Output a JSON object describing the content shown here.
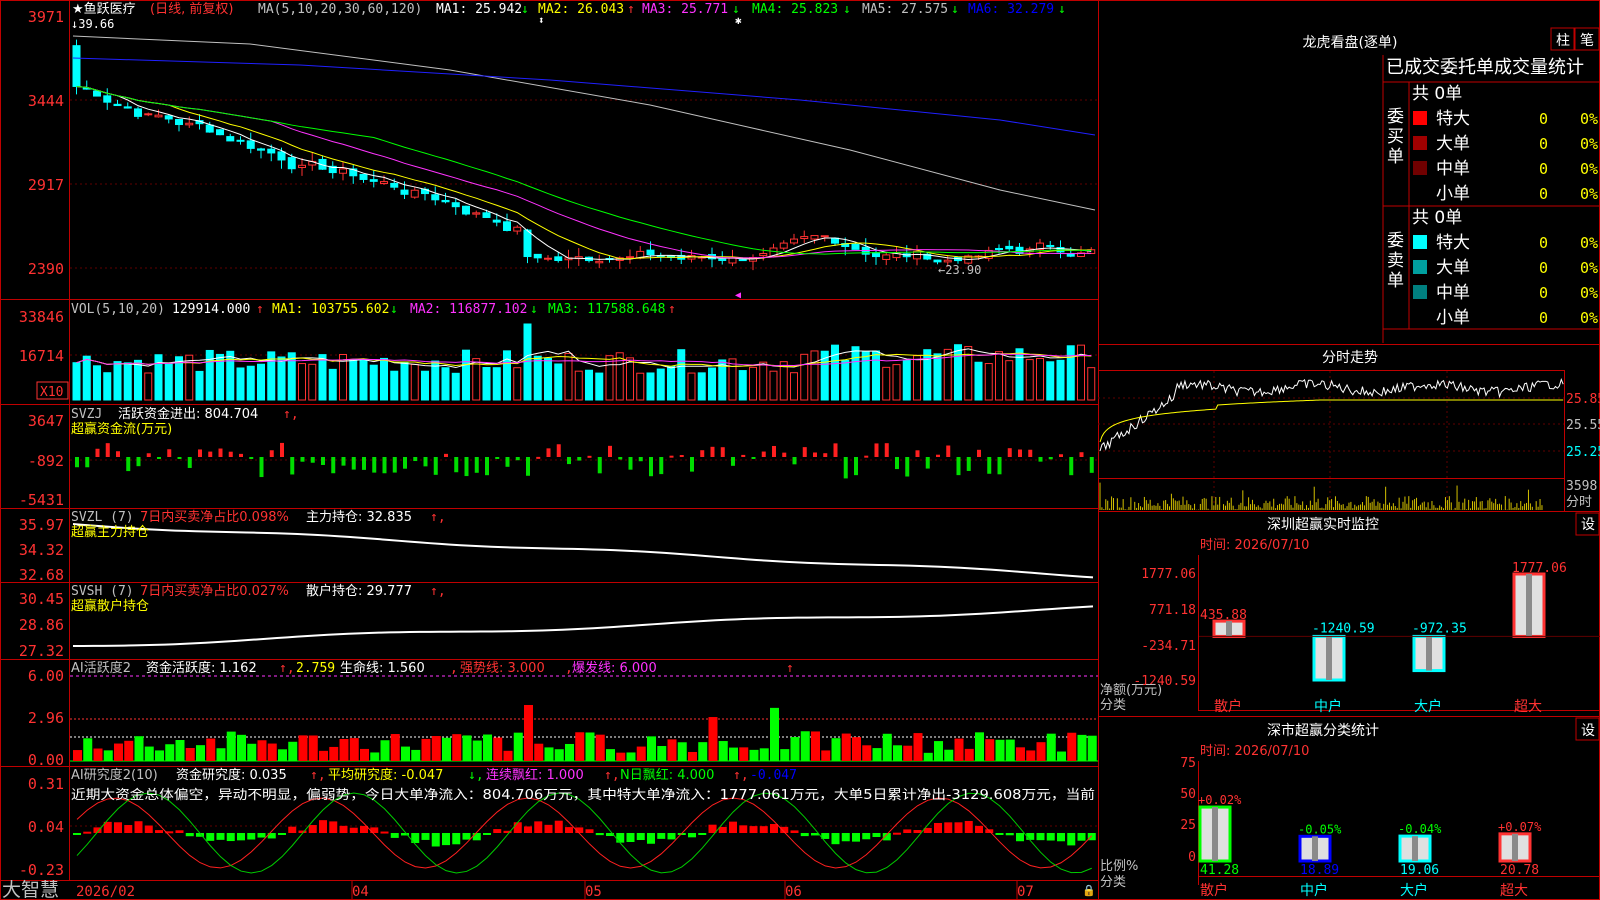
{
  "stock": {
    "name": "★鱼跃医疗",
    "period": "(日线, 前复权)",
    "ma_label": "MA(5,10,20,30,60,120)",
    "ma": [
      {
        "label": "MA1: 25.942",
        "arrow": "↓",
        "color": "#ffffff"
      },
      {
        "label": "MA2: 26.043",
        "arrow": "↑",
        "color": "#ffff00"
      },
      {
        "label": "MA3: 25.771",
        "arrow": "↓",
        "color": "#ff33ff"
      },
      {
        "label": "MA4: 25.823",
        "arrow": "↓",
        "color": "#00ff00"
      },
      {
        "label": "MA5: 27.575",
        "arrow": "↓",
        "color": "#c0c0c0"
      },
      {
        "label": "MA6: 32.279",
        "arrow": "↓",
        "color": "#0000ff"
      }
    ],
    "high_label": "39.66",
    "low_label": "←23.90",
    "price_axis": [
      "3971",
      "3444",
      "2917",
      "2390"
    ]
  },
  "volume": {
    "title": "VOL(5,10,20)",
    "value": "129914.000",
    "ma1": "MA1: 103755.602",
    "ma2": "MA2: 116877.102",
    "ma3": "MA3: 117588.648",
    "axis": [
      "33846",
      "16714"
    ],
    "unit": "X10"
  },
  "svzj": {
    "title": "SVZJ",
    "label": "活跃资金进出: 804.704",
    "subtitle": "超赢资金流(万元)",
    "axis": [
      "3647",
      "-892",
      "-5431"
    ]
  },
  "svzl": {
    "title": "SVZL (7)",
    "ratio": "7日内买卖净占比0.098%",
    "hold": "主力持仓: 32.835",
    "subtitle": "超赢主力持仓",
    "axis": [
      "35.97",
      "34.32",
      "32.68"
    ]
  },
  "svsh": {
    "title": "SVSH (7)",
    "ratio": "7日内买卖净占比0.027%",
    "hold": "散户持仓: 29.777",
    "subtitle": "超赢散户持仓",
    "axis": [
      "30.45",
      "28.86",
      "27.32"
    ]
  },
  "ai_active": {
    "title": "AI活跃度2",
    "label": "资金活跃度: 1.162",
    "v2": "2.759",
    "life": "生命线: 1.560",
    "strong": "强势线: 3.000",
    "burst": "爆发线: 6.000",
    "axis": [
      "6.00",
      "2.96",
      "0.00"
    ]
  },
  "ai_research": {
    "title": "AI研究度2(10)",
    "label": "资金研究度: 0.035",
    "avg": "平均研究度: -0.047",
    "red": "连续飘红: 1.000",
    "nred": "N日飘红: 4.000",
    "last": "-0.047",
    "summary": "近期大资金总体偏空，异动不明显，偏弱势，今日大单净流入：804.706万元，其中特大单净流入：1777.061万元，大单5日累计净出-3129.608万元，当前",
    "axis": [
      "0.31",
      "0.04",
      "-0.23"
    ]
  },
  "date_axis": [
    "2026/02",
    "04",
    "05",
    "06",
    "07"
  ],
  "brand": "大智慧",
  "right_panel": {
    "dragon_tiger": {
      "title": "龙虎看盘(逐单)",
      "tabs": [
        "柱",
        "笔"
      ],
      "header": "已成交委托单成交量统计",
      "buy": {
        "side": [
          "委",
          "买",
          "单"
        ],
        "total": "共 0单",
        "rows": [
          {
            "name": "特大",
            "count": "0",
            "pct": "0%",
            "color": "#ff0000"
          },
          {
            "name": "大单",
            "count": "0",
            "pct": "0%",
            "color": "#a00000"
          },
          {
            "name": "中单",
            "count": "0",
            "pct": "0%",
            "color": "#700000"
          },
          {
            "name": "小单",
            "count": "0",
            "pct": "0%",
            "color": ""
          }
        ]
      },
      "sell": {
        "side": [
          "委",
          "卖",
          "单"
        ],
        "total": "共 0单",
        "rows": [
          {
            "name": "特大",
            "count": "0",
            "pct": "0%",
            "color": "#00ffff"
          },
          {
            "name": "大单",
            "count": "0",
            "pct": "0%",
            "color": "#00a0a0"
          },
          {
            "name": "中单",
            "count": "0",
            "pct": "0%",
            "color": "#008080"
          },
          {
            "name": "小单",
            "count": "0",
            "pct": "0%",
            "color": ""
          }
        ]
      }
    },
    "intraday": {
      "title": "分时走势",
      "axis": [
        "25.85",
        "25.55",
        "25.25"
      ],
      "vol_label": "3598",
      "time_label": "分时"
    },
    "sz_monitor": {
      "title": "深圳超赢实时监控",
      "settings": "设",
      "time": "时间: 2026/07/10",
      "axis": [
        "1777.06",
        "771.18",
        "-234.71",
        "-1240.59"
      ],
      "unit_label": "净额(万元)",
      "cat_label": "分类",
      "bars": [
        {
          "name": "散户",
          "value": 435.88,
          "label": "435.88"
        },
        {
          "name": "中户",
          "value": -1240.59,
          "label": "-1240.59"
        },
        {
          "name": "大户",
          "value": -972.35,
          "label": "-972.35"
        },
        {
          "name": "超大",
          "value": 1777.06,
          "label": "1777.06"
        }
      ]
    },
    "sz_category": {
      "title": "深市超赢分类统计",
      "settings": "设",
      "time": "时间: 2026/07/10",
      "axis": [
        "75",
        "50",
        "25",
        "0"
      ],
      "unit_label": "比例%",
      "cat_label": "分类",
      "bars": [
        {
          "name": "散户",
          "value": 41.28,
          "label": "41.28",
          "delta": "+0.02%"
        },
        {
          "name": "中户",
          "value": 18.89,
          "label": "18.89",
          "delta": "-0.05%"
        },
        {
          "name": "大户",
          "value": 19.06,
          "label": "19.06",
          "delta": "-0.04%"
        },
        {
          "name": "超大",
          "value": 20.78,
          "label": "20.78",
          "delta": "+0.07%"
        }
      ]
    }
  },
  "colors": {
    "up": "#ff3232",
    "down": "#00ffff",
    "grid": "#c00000",
    "axis_text": "#ff3232"
  }
}
